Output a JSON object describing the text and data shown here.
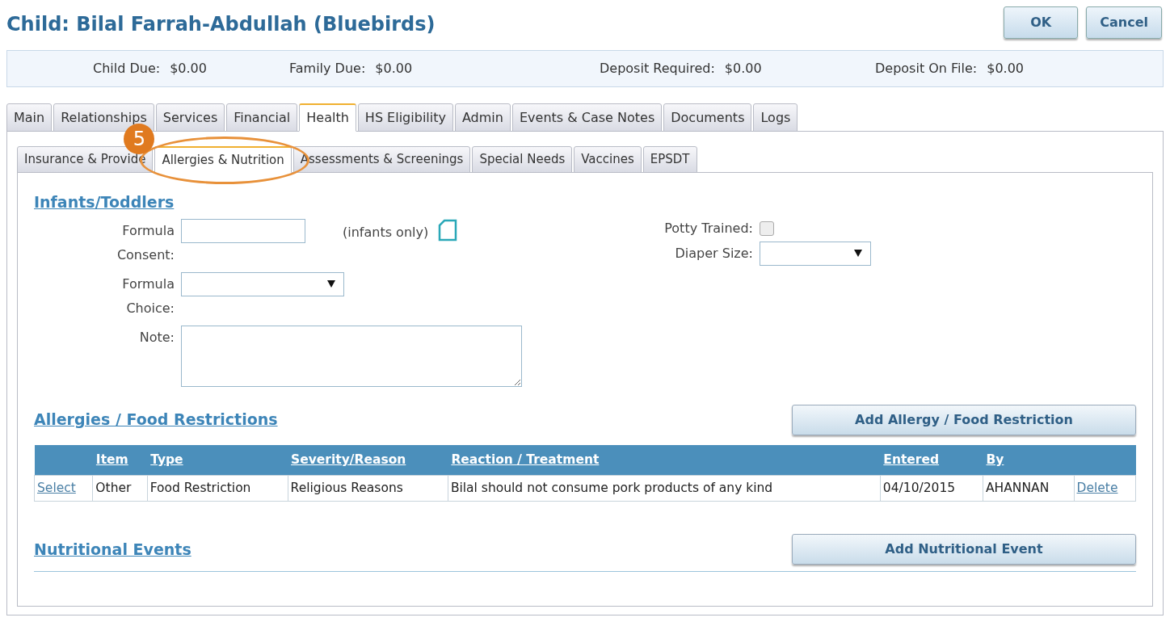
{
  "title": "Child: Bilal Farrah-Abdullah (Bluebirds)",
  "buttons": [
    {
      "label": "OK"
    },
    {
      "label": "Cancel"
    }
  ],
  "summary": [
    {
      "label": "Child Due:",
      "value": "$0.00"
    },
    {
      "label": "Family Due:",
      "value": "$0.00"
    },
    {
      "label": "Deposit Required:",
      "value": "$0.00"
    },
    {
      "label": "Deposit On File:",
      "value": "$0.00"
    }
  ],
  "tabs": [
    {
      "label": "Main",
      "selected": false
    },
    {
      "label": "Relationships",
      "selected": false
    },
    {
      "label": "Services",
      "selected": false
    },
    {
      "label": "Financial",
      "selected": false
    },
    {
      "label": "Health",
      "selected": true
    },
    {
      "label": "HS Eligibility",
      "selected": false
    },
    {
      "label": "Admin",
      "selected": false
    },
    {
      "label": "Events & Case Notes",
      "selected": false
    },
    {
      "label": "Documents",
      "selected": false
    },
    {
      "label": "Logs",
      "selected": false
    }
  ],
  "subtabs": [
    {
      "label": "Insurance & Provide",
      "selected": false
    },
    {
      "label": "Allergies & Nutrition",
      "selected": true,
      "callout": "5"
    },
    {
      "label": "Assessments & Screenings",
      "selected": false
    },
    {
      "label": "Special Needs",
      "selected": false
    },
    {
      "label": "Vaccines",
      "selected": false
    },
    {
      "label": "EPSDT",
      "selected": false
    }
  ],
  "infants": {
    "heading": "Infants/Toddlers",
    "left_fields": [
      {
        "kind": "text",
        "label": "Formula Consent:",
        "hint": "(infants only)"
      },
      {
        "kind": "select",
        "label": "Formula Choice:"
      },
      {
        "kind": "textarea",
        "label": "Note:"
      }
    ],
    "right_fields": [
      {
        "kind": "checkbox",
        "label": "Potty Trained:",
        "checked": false
      },
      {
        "kind": "select",
        "label": "Diaper Size:"
      }
    ]
  },
  "allergies": {
    "heading": "Allergies / Food Restrictions",
    "button": "Add Allergy / Food Restriction",
    "columns": [
      "Item",
      "Type",
      "Severity/Reason",
      "Reaction / Treatment",
      "Entered",
      "By"
    ],
    "rows": [
      {
        "select": "Select",
        "cells": [
          "Other",
          "Food Restriction",
          "Religious Reasons",
          "Bilal should not consume pork products of any kind",
          "04/10/2015",
          "AHANNAN"
        ],
        "delete": "Delete"
      }
    ]
  },
  "nutrition": {
    "heading": "Nutritional Events",
    "button": "Add Nutritional Event"
  }
}
